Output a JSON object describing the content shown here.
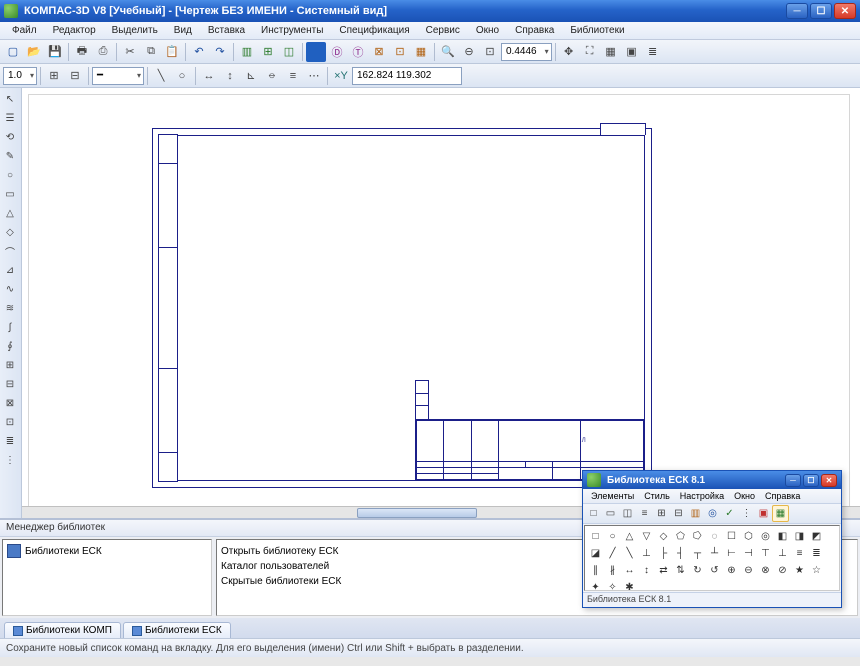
{
  "window": {
    "title": "КОМПАС-3D V8 [Учебный] - [Чертеж БЕЗ ИМЕНИ - Системный вид]",
    "min": "─",
    "max": "☐",
    "close": "✕"
  },
  "menu": [
    "Файл",
    "Редактор",
    "Выделить",
    "Вид",
    "Вставка",
    "Инструменты",
    "Спецификация",
    "Сервис",
    "Окно",
    "Справка",
    "Библиотеки"
  ],
  "toolbar1": {
    "combos": {
      "zoom": "0.4446"
    },
    "coords": "162.824  119.302"
  },
  "toolbar2": {
    "scale": "1.0"
  },
  "library_manager": {
    "title": "Менеджер библиотек",
    "tree_item": "Библиотеки ЕСК",
    "list": [
      "Открыть библиотеку ЕСК",
      "Каталог пользователей",
      "Скрытые библиотеки ЕСК"
    ],
    "tabs": [
      "Библиотеки КОМП",
      "Библиотеки ЕСК"
    ]
  },
  "status": "Сохраните новый список команд на вкладку. Для его выделения (имени) Ctrl или Shift + выбрать в разделении.",
  "float": {
    "title": "Библиотека ЕСК 8.1",
    "menu": [
      "Элементы",
      "Стиль",
      "Настройка",
      "Окно",
      "Справка"
    ],
    "status": "Библиотека ЕСК 8.1"
  },
  "palette_glyphs": [
    "□",
    "○",
    "△",
    "▽",
    "◇",
    "⬠",
    "⭔",
    "◌",
    "☐",
    "⬡",
    "◎",
    "◧",
    "◨",
    "◩",
    "◪",
    "╱",
    "╲",
    "⊥",
    "├",
    "┤",
    "┬",
    "┴",
    "⊢",
    "⊣",
    "⊤",
    "⊥",
    "≡",
    "≣",
    "∥",
    "∦",
    "↔",
    "↕",
    "⇄",
    "⇅",
    "↻",
    "↺",
    "⊕",
    "⊖",
    "⊗",
    "⊘",
    "★",
    "☆",
    "✦",
    "✧",
    "✱"
  ],
  "side_glyphs": [
    "↖",
    "☰",
    "⟲",
    "✎",
    "○",
    "▭",
    "△",
    "◇",
    "⌒",
    "⊿",
    "∿",
    "≋",
    "∫",
    "∮",
    "⊞",
    "⊟",
    "⊠",
    "⊡",
    "≣",
    "⋮"
  ]
}
